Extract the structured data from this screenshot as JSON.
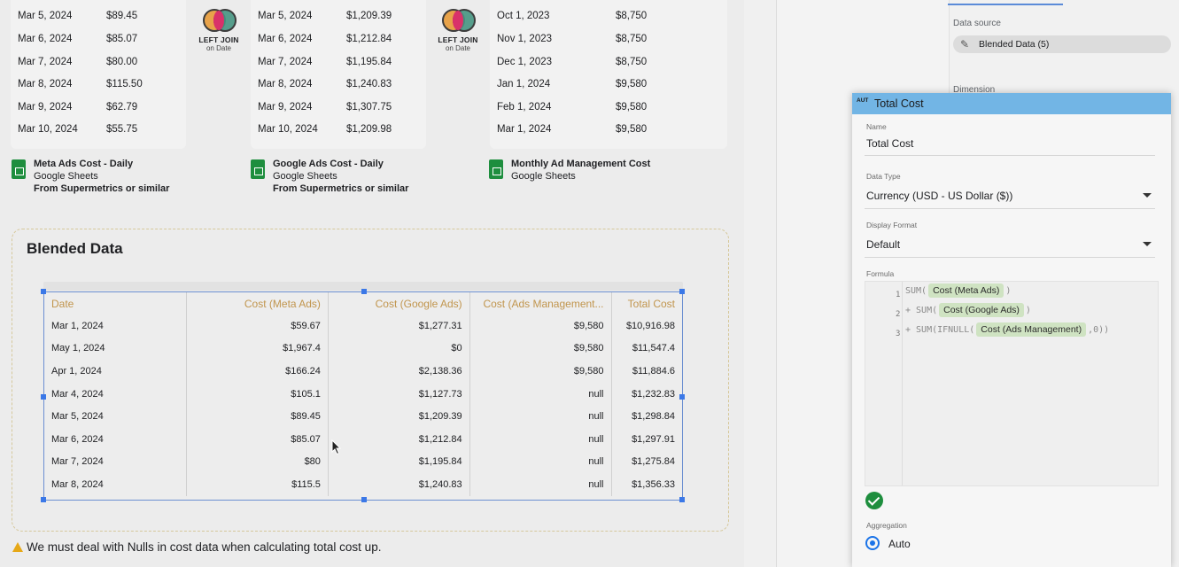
{
  "sources": [
    {
      "rows": [
        {
          "date": "Mar 5, 2024",
          "value": "$89.45"
        },
        {
          "date": "Mar 6, 2024",
          "value": "$85.07"
        },
        {
          "date": "Mar 7, 2024",
          "value": "$80.00"
        },
        {
          "date": "Mar 8, 2024",
          "value": "$115.50"
        },
        {
          "date": "Mar 9, 2024",
          "value": "$62.79"
        },
        {
          "date": "Mar 10, 2024",
          "value": "$55.75"
        }
      ],
      "title": "Meta Ads Cost - Daily",
      "subtitle": "Google Sheets",
      "note": "From Supermetrics or similar"
    },
    {
      "rows": [
        {
          "date": "Mar 5, 2024",
          "value": "$1,209.39"
        },
        {
          "date": "Mar 6, 2024",
          "value": "$1,212.84"
        },
        {
          "date": "Mar 7, 2024",
          "value": "$1,195.84"
        },
        {
          "date": "Mar 8, 2024",
          "value": "$1,240.83"
        },
        {
          "date": "Mar 9, 2024",
          "value": "$1,307.75"
        },
        {
          "date": "Mar 10, 2024",
          "value": "$1,209.98"
        }
      ],
      "title": "Google Ads Cost - Daily",
      "subtitle": "Google Sheets",
      "note": "From Supermetrics or similar"
    },
    {
      "rows": [
        {
          "date": "Oct 1, 2023",
          "value": "$8,750"
        },
        {
          "date": "Nov 1, 2023",
          "value": "$8,750"
        },
        {
          "date": "Dec 1, 2023",
          "value": "$8,750"
        },
        {
          "date": "Jan 1, 2024",
          "value": "$9,580"
        },
        {
          "date": "Feb 1, 2024",
          "value": "$9,580"
        },
        {
          "date": "Mar 1, 2024",
          "value": "$9,580"
        }
      ],
      "title": "Monthly Ad Management Cost",
      "subtitle": "Google Sheets",
      "note": ""
    }
  ],
  "join": {
    "type": "LEFT JOIN",
    "key": "on Date"
  },
  "blended": {
    "title": "Blended Data",
    "columns": [
      "Date",
      "Cost (Meta Ads)",
      "Cost (Google Ads)",
      "Cost (Ads Management...",
      "Total Cost"
    ],
    "rows": [
      [
        "Mar 1, 2024",
        "$59.67",
        "$1,277.31",
        "$9,580",
        "$10,916.98"
      ],
      [
        "May 1, 2024",
        "$1,967.4",
        "$0",
        "$9,580",
        "$11,547.4"
      ],
      [
        "Apr 1, 2024",
        "$166.24",
        "$2,138.36",
        "$9,580",
        "$11,884.6"
      ],
      [
        "Mar 4, 2024",
        "$105.1",
        "$1,127.73",
        "null",
        "$1,232.83"
      ],
      [
        "Mar 5, 2024",
        "$89.45",
        "$1,209.39",
        "null",
        "$1,298.84"
      ],
      [
        "Mar 6, 2024",
        "$85.07",
        "$1,212.84",
        "null",
        "$1,297.91"
      ],
      [
        "Mar 7, 2024",
        "$80",
        "$1,195.84",
        "null",
        "$1,275.84"
      ],
      [
        "Mar 8, 2024",
        "$115.5",
        "$1,240.83",
        "null",
        "$1,356.33"
      ]
    ]
  },
  "warning": "We must deal with Nulls in cost data when calculating total cost up.",
  "datasource_panel": {
    "label": "Data source",
    "value": "Blended Data (5)",
    "dimension_label": "Dimension"
  },
  "editor": {
    "badge": "AUT",
    "title": "Total Cost",
    "name_label": "Name",
    "name_value": "Total Cost",
    "type_label": "Data Type",
    "type_value": "Currency (USD - US Dollar ($))",
    "format_label": "Display Format",
    "format_value": "Default",
    "formula_label": "Formula",
    "lines": [
      {
        "num": "1",
        "pre": "SUM(",
        "field": "Cost (Meta Ads)",
        "post": ")"
      },
      {
        "num": "2",
        "pre": "+ SUM(",
        "field": "Cost (Google Ads)",
        "post": ")"
      },
      {
        "num": "3",
        "pre": "+ SUM(IFNULL(",
        "field": "Cost (Ads Management)",
        "post": ",0))"
      }
    ],
    "aggregation_label": "Aggregation",
    "aggregation_value": "Auto",
    "colors": {
      "header": "#72b5e5",
      "chip": "#cfe3c2",
      "valid": "#1e8e3e"
    }
  }
}
